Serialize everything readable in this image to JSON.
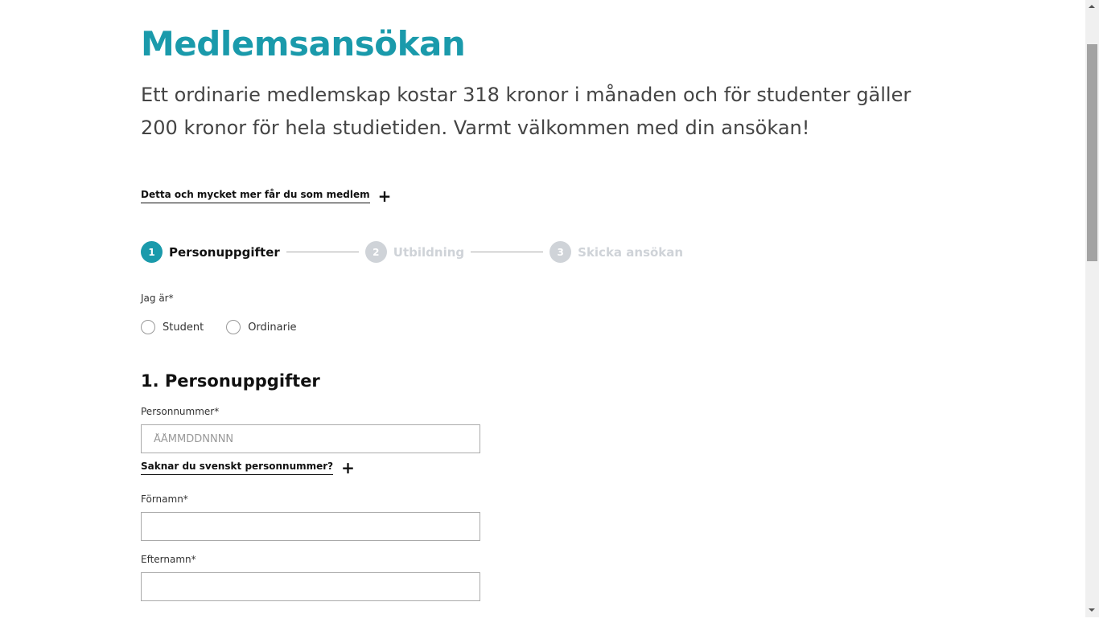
{
  "title": "Medlemsansökan",
  "intro": "Ett ordinarie medlemskap kostar 318 kronor i månaden och för studenter gäller 200 kronor för hela studietiden. Varmt välkommen med din ansökan!",
  "more_link": "Detta och mycket mer får du som medlem",
  "steps": [
    {
      "num": "1",
      "label": "Personuppgifter"
    },
    {
      "num": "2",
      "label": "Utbildning"
    },
    {
      "num": "3",
      "label": "Skicka ansökan"
    }
  ],
  "colors": {
    "accent": "#1a9aab",
    "inactive": "#cfd3d8"
  },
  "member_type": {
    "label": "Jag är*",
    "options": [
      "Student",
      "Ordinarie"
    ]
  },
  "section_title": "1. Personuppgifter",
  "fields": {
    "personnummer": {
      "label": "Personnummer*",
      "placeholder": "ÅÅMMDDNNNN",
      "value": ""
    },
    "no_pnr_link": "Saknar du svenskt personnummer?",
    "fornamn": {
      "label": "Förnamn*",
      "value": ""
    },
    "efternamn": {
      "label": "Efternamn*",
      "value": ""
    }
  }
}
